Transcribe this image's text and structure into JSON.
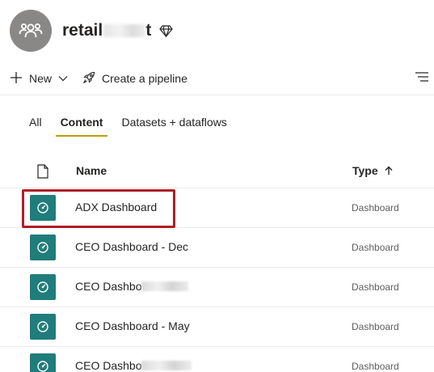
{
  "workspace": {
    "title_visible": "retail",
    "title_tail": "t",
    "avatar_icon": "people-group-icon",
    "premium_icon": "diamond-icon"
  },
  "toolbar": {
    "new_label": "New",
    "pipeline_label": "Create a pipeline",
    "filter_icon": "filter-lines-icon"
  },
  "tabs": [
    {
      "label": "All",
      "active": false
    },
    {
      "label": "Content",
      "active": true
    },
    {
      "label": "Datasets + dataflows",
      "active": false
    }
  ],
  "table": {
    "columns": {
      "name": "Name",
      "type": "Type",
      "sort": "ascending"
    },
    "rows": [
      {
        "name": "ADX Dashboard",
        "type": "Dashboard",
        "highlighted": true
      },
      {
        "name": "CEO Dashboard - Dec",
        "type": "Dashboard"
      },
      {
        "name": "CEO Dashbo",
        "type": "Dashboard",
        "partially_obscured": true
      },
      {
        "name": "CEO Dashboard - May",
        "type": "Dashboard"
      },
      {
        "name": "CEO Dashbo",
        "type": "Dashboard",
        "partially_obscured": true
      }
    ]
  },
  "colors": {
    "accent_tab": "#c19c00",
    "dashboard_icon_bg": "#1f7d7b",
    "highlight_border": "#b01e24"
  }
}
